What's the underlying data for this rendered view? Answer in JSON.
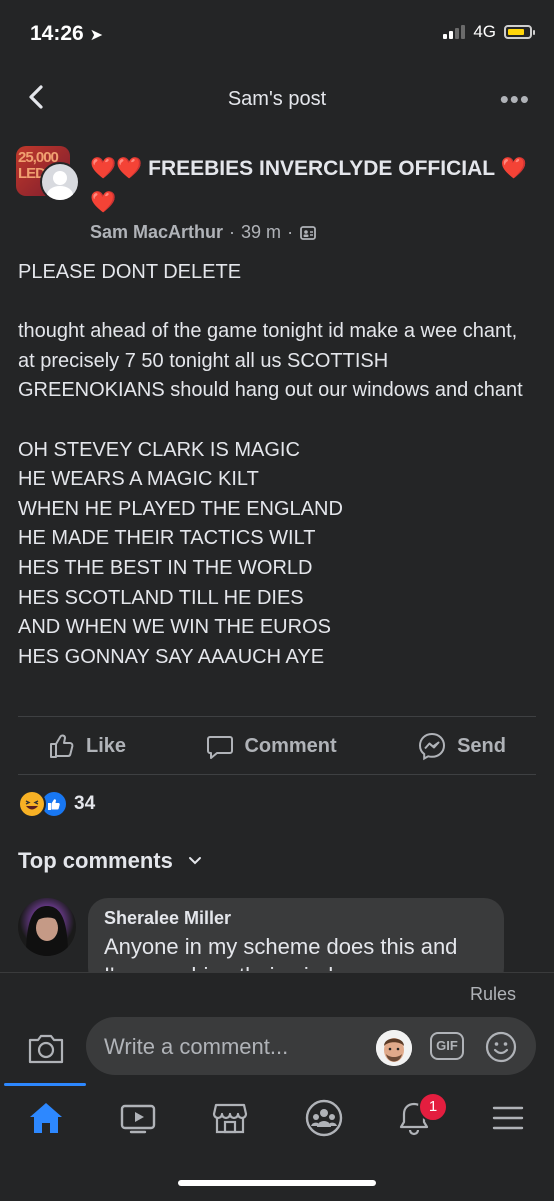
{
  "status": {
    "time": "14:26",
    "network": "4G"
  },
  "header": {
    "title": "Sam's post",
    "back_icon": "chevron-left-icon",
    "more_icon": "more-dots-icon"
  },
  "post": {
    "group_avatar_text": "25,000 LED",
    "group_name": "❤️❤️ FREEBIES INVERCLYDE OFFICIAL ❤️❤️",
    "author": "Sam MacArthur",
    "time": "39 m",
    "separator": "·",
    "body": [
      "PLEASE DONT DELETE",
      "",
      "thought ahead of the game tonight id make a wee chant, at precisely 7 50 tonight all us SCOTTISH GREENOKIANS should hang out our windows and chant",
      "",
      "OH STEVEY CLARK IS MAGIC",
      "HE WEARS A MAGIC KILT",
      "WHEN HE PLAYED THE ENGLAND",
      "HE MADE THEIR TACTICS WILT",
      "HES THE BEST IN THE WORLD",
      "HES SCOTLAND TILL HE DIES",
      "AND WHEN WE WIN THE EUROS",
      "HES GONNAY SAY AAAUCH AYE"
    ]
  },
  "actions": {
    "like": "Like",
    "comment": "Comment",
    "send": "Send"
  },
  "reactions": {
    "count": "34"
  },
  "comments": {
    "section_title": "Top comments",
    "items": [
      {
        "name": "Sheralee Miller",
        "text": "Anyone in my scheme does this and",
        "text_cont": "I'm smashing their windows"
      }
    ]
  },
  "composer": {
    "rules": "Rules",
    "placeholder": "Write a comment...",
    "gif": "GIF"
  },
  "nav": {
    "notifications_badge": "1"
  },
  "colors": {
    "background": "#242526",
    "accent": "#2d88ff",
    "badge": "#e41e3f",
    "bubble": "#3a3b3c"
  }
}
